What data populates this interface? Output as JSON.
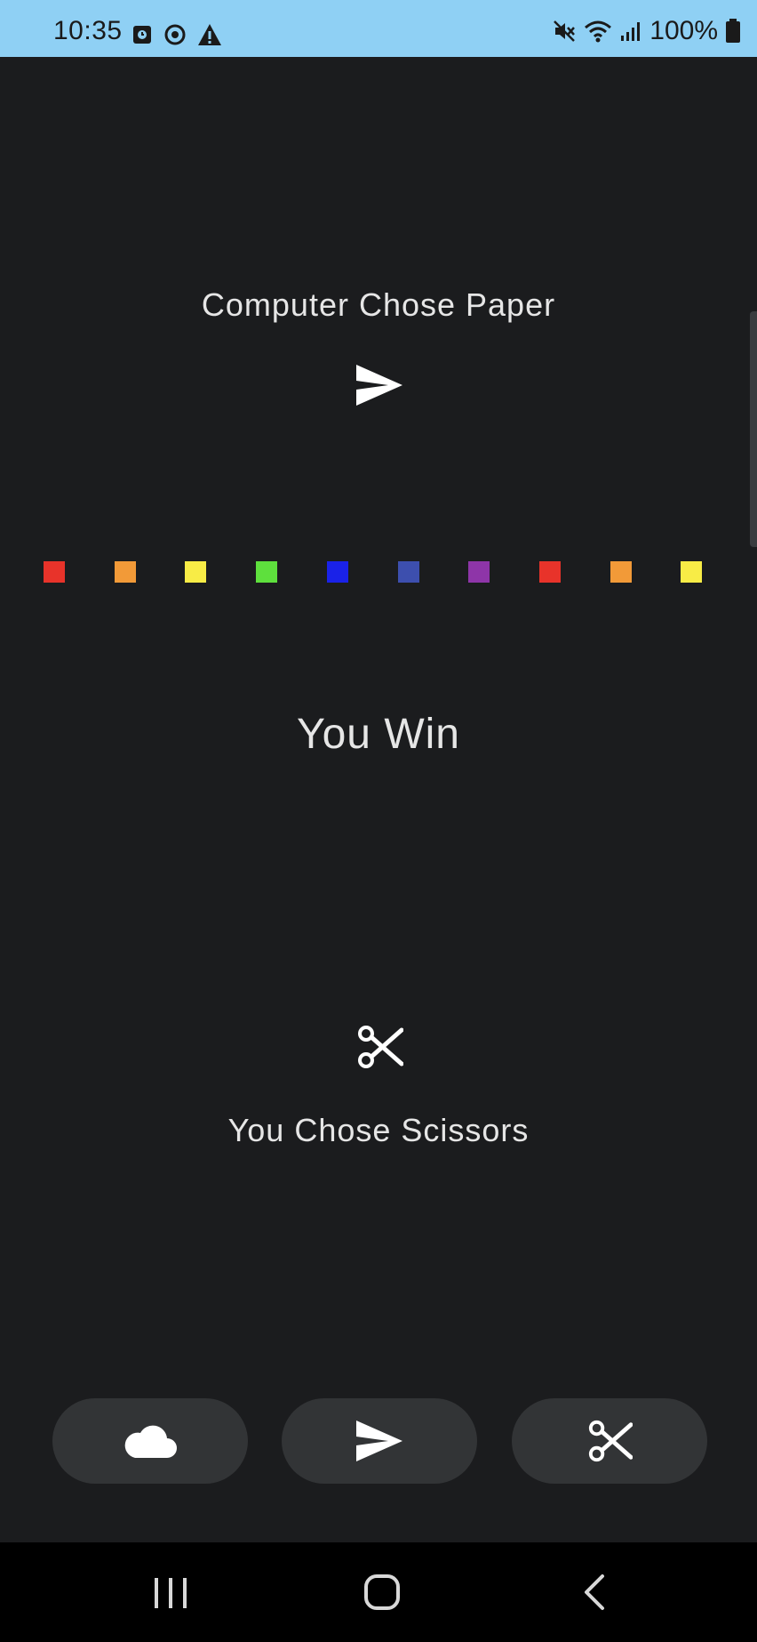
{
  "status_bar": {
    "time": "10:35",
    "battery_percent": "100%",
    "left_icons": [
      "alarm-icon",
      "sync-icon",
      "warning-icon"
    ],
    "right_icons": [
      "mute-icon",
      "wifi-icon",
      "signal-icon",
      "battery-icon"
    ],
    "background_color": "#8fd0f4"
  },
  "computer": {
    "label": "Computer Chose Paper",
    "choice_icon": "paper-plane-icon"
  },
  "confetti": {
    "colors": [
      "#e8332a",
      "#f29a38",
      "#f8ec46",
      "#5ee03d",
      "#1a22e8",
      "#3d4fae",
      "#8e35a8",
      "#e8332a",
      "#f29a38",
      "#f8ec46"
    ]
  },
  "result": {
    "text": "You Win"
  },
  "player": {
    "label": "You Chose Scissors",
    "choice_icon": "scissors-icon"
  },
  "buttons": [
    {
      "name": "rock-button",
      "icon": "cloud-icon"
    },
    {
      "name": "paper-button",
      "icon": "paper-plane-icon"
    },
    {
      "name": "scissors-button",
      "icon": "scissors-icon"
    }
  ],
  "nav_bar": {
    "items": [
      "recent-apps-icon",
      "home-icon",
      "back-icon"
    ]
  }
}
